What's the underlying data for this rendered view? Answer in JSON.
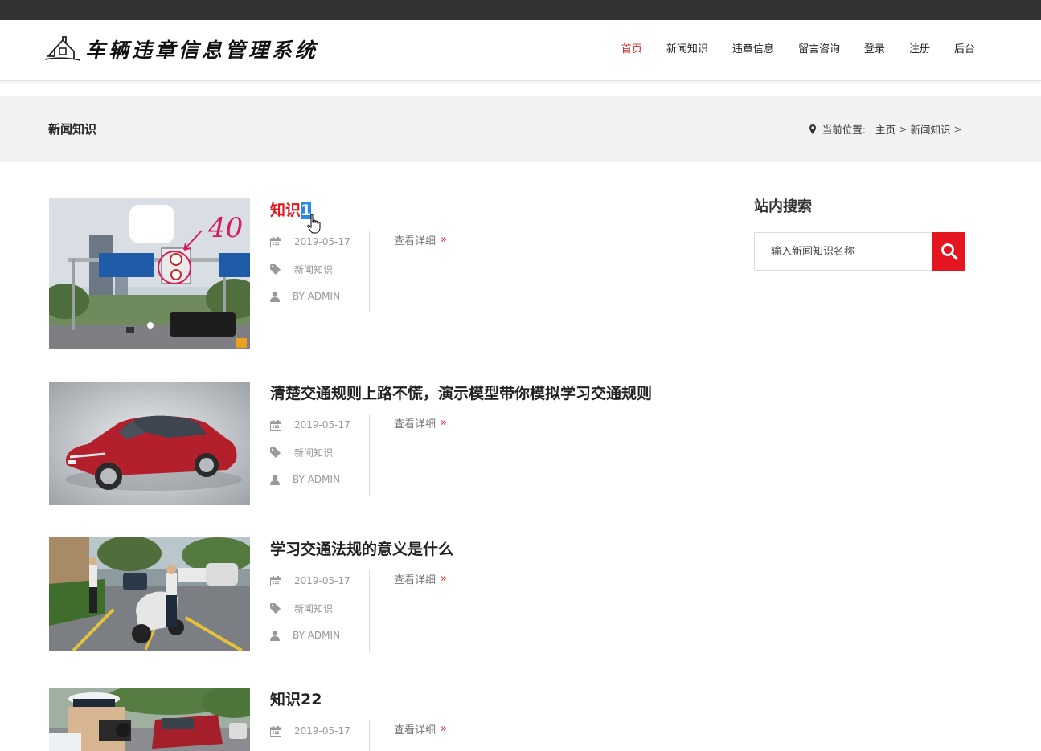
{
  "site": {
    "logo_text": "车辆违章信息管理系统"
  },
  "nav": {
    "items": [
      {
        "label": "首页",
        "active": true
      },
      {
        "label": "新闻知识"
      },
      {
        "label": "违章信息"
      },
      {
        "label": "留言咨询"
      },
      {
        "label": "登录"
      },
      {
        "label": "注册"
      },
      {
        "label": "后台"
      }
    ]
  },
  "banner": {
    "title": "新闻知识",
    "location_label": "当前位置:",
    "crumbs": [
      "主页",
      "新闻知识"
    ],
    "crumb_sep": ">"
  },
  "posts": [
    {
      "title_main": "知识",
      "title_selected": "1",
      "date": "2019-05-17",
      "category": "新闻知识",
      "author": "BY ADMIN",
      "more": "查看详细",
      "image": "traffic-sign-photo"
    },
    {
      "title": "清楚交通规则上路不慌，演示模型带你模拟学习交通规则",
      "date": "2019-05-17",
      "category": "新闻知识",
      "author": "BY ADMIN",
      "more": "查看详细",
      "image": "red-car-model-photo"
    },
    {
      "title": "学习交通法规的意义是什么",
      "date": "2019-05-17",
      "category": "新闻知识",
      "author": "BY ADMIN",
      "more": "查看详细",
      "image": "traffic-police-photo"
    },
    {
      "title": "知识22",
      "date": "2019-05-17",
      "more": "查看详细",
      "image": "police-camera-photo"
    }
  ],
  "sidebar": {
    "title": "站内搜索",
    "search_placeholder": "输入新闻知识名称"
  },
  "colors": {
    "accent": "#e4151f",
    "topbar": "#333333",
    "banner_bg": "#f2f2f2",
    "selection": "#2a8ae8"
  }
}
